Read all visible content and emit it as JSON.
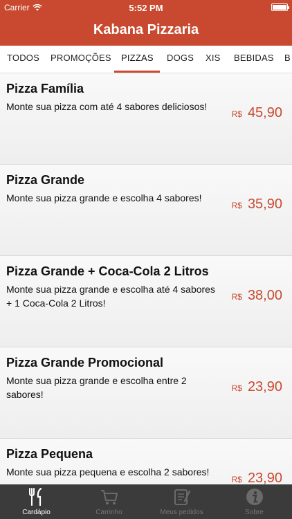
{
  "status": {
    "carrier": "Carrier",
    "time": "5:52 PM"
  },
  "header": {
    "title": "Kabana Pizzaria"
  },
  "categories": [
    {
      "label": "TODOS",
      "active": false
    },
    {
      "label": "PROMOÇÕES",
      "active": false
    },
    {
      "label": "PIZZAS",
      "active": true
    },
    {
      "label": "DOGS",
      "active": false
    },
    {
      "label": "XIS",
      "active": false
    },
    {
      "label": "BEBIDAS",
      "active": false
    },
    {
      "label": "B",
      "active": false
    }
  ],
  "products": [
    {
      "name": "Pizza Família",
      "description": "Monte sua pizza com até 4 sabores deliciosos!",
      "currency": "R$",
      "price": "45,90"
    },
    {
      "name": "Pizza Grande",
      "description": "Monte sua pizza grande e escolha 4 sabores!",
      "currency": "R$",
      "price": "35,90"
    },
    {
      "name": "Pizza Grande + Coca-Cola 2 Litros",
      "description": "Monte sua pizza grande e escolha até 4 sabores + 1 Coca-Cola 2 Litros!",
      "currency": "R$",
      "price": "38,00"
    },
    {
      "name": "Pizza Grande Promocional",
      "description": "Monte sua pizza grande e escolha entre 2 sabores!",
      "currency": "R$",
      "price": "23,90"
    },
    {
      "name": "Pizza Pequena",
      "description": "Monte sua pizza pequena e escolha 2 sabores!",
      "currency": "R$",
      "price": "23,90"
    }
  ],
  "tabbar": [
    {
      "label": "Cardápio",
      "icon": "cutlery-icon",
      "active": true
    },
    {
      "label": "Carrinho",
      "icon": "cart-icon",
      "active": false
    },
    {
      "label": "Meus pedidos",
      "icon": "order-list-icon",
      "active": false
    },
    {
      "label": "Sobre",
      "icon": "info-icon",
      "active": false
    }
  ],
  "colors": {
    "brand": "#c8492f",
    "tabbar": "#3b3b3b",
    "inactive": "#777777"
  }
}
